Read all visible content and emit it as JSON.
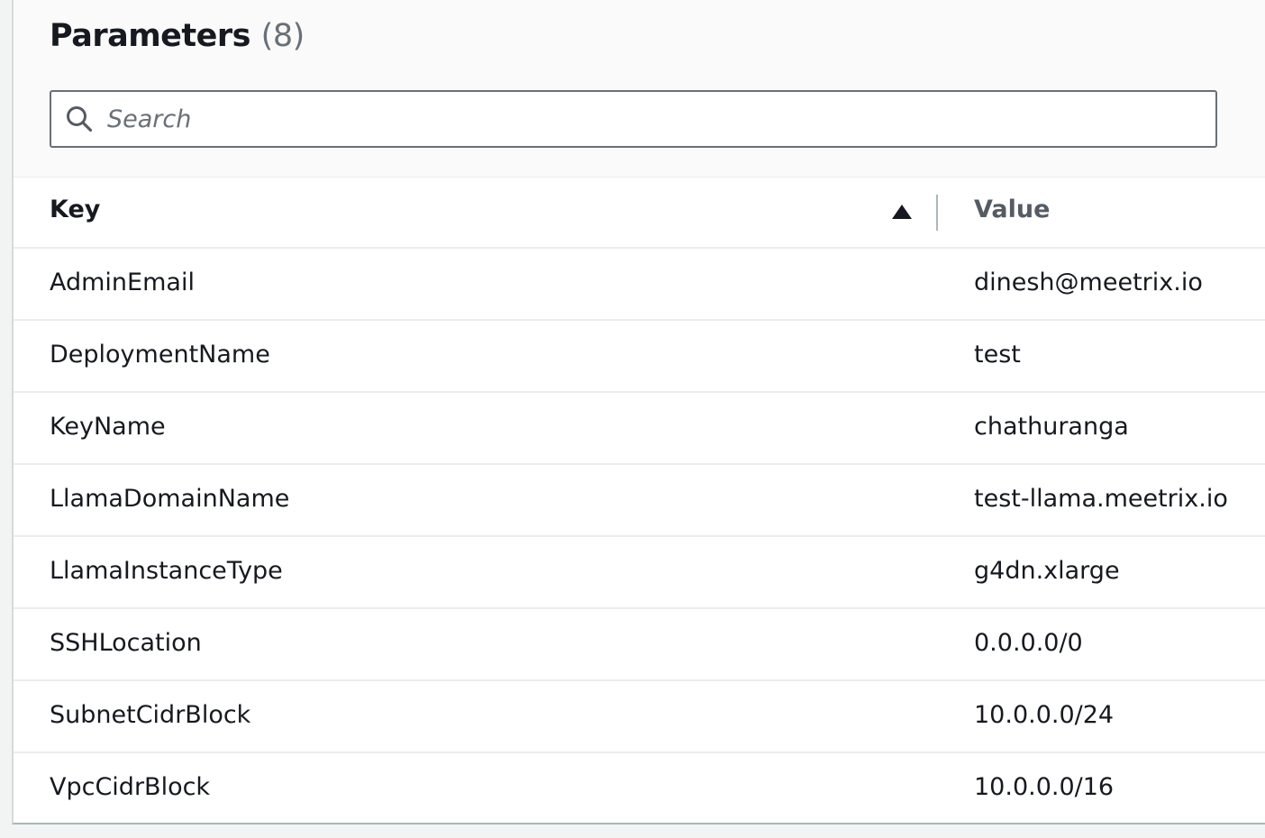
{
  "header": {
    "title": "Parameters",
    "count": "(8)"
  },
  "search": {
    "placeholder": "Search",
    "value": "",
    "icon": "search-icon"
  },
  "table": {
    "columns": {
      "key": "Key",
      "value": "Value"
    },
    "sort": {
      "column": "Key",
      "direction": "ascending",
      "icon": "sort-ascending-icon"
    },
    "rows": [
      {
        "key": "AdminEmail",
        "value": "dinesh@meetrix.io"
      },
      {
        "key": "DeploymentName",
        "value": "test"
      },
      {
        "key": "KeyName",
        "value": "chathuranga"
      },
      {
        "key": "LlamaDomainName",
        "value": "test-llama.meetrix.io"
      },
      {
        "key": "LlamaInstanceType",
        "value": "g4dn.xlarge"
      },
      {
        "key": "SSHLocation",
        "value": "0.0.0.0/0"
      },
      {
        "key": "SubnetCidrBlock",
        "value": "10.0.0.0/24"
      },
      {
        "key": "VpcCidrBlock",
        "value": "10.0.0.0/16"
      }
    ]
  },
  "colors": {
    "text": "#16191f",
    "muted": "#687078",
    "border": "#eaeded",
    "panel_background": "#ffffff",
    "header_background": "#fafafa"
  }
}
